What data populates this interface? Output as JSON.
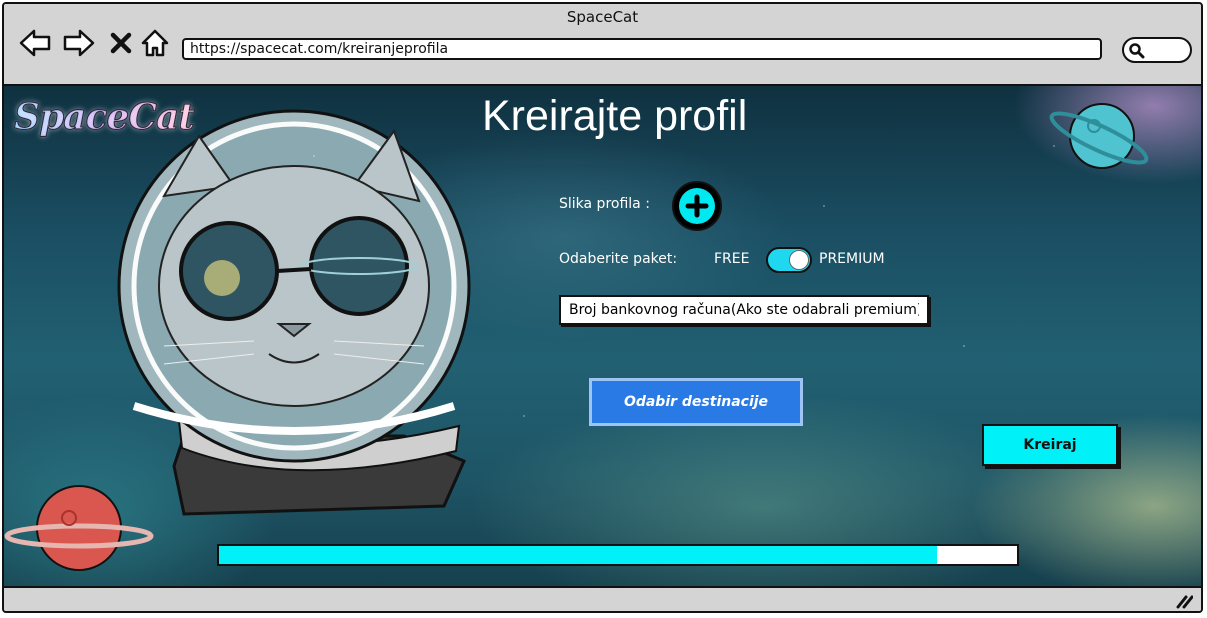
{
  "window": {
    "title": "SpaceCat"
  },
  "toolbar": {
    "back_icon": "arrow-left-icon",
    "forward_icon": "arrow-right-icon",
    "stop_icon": "close-icon",
    "home_icon": "home-icon",
    "url": "https://spacecat.com/kreiranjeprofila",
    "search_icon": "search-icon"
  },
  "logo": {
    "text": "SpaceCat"
  },
  "page": {
    "title": "Kreirajte profil"
  },
  "form": {
    "photo_label": "Slika profila :",
    "package_label": "Odaberite paket:",
    "package_free": "FREE",
    "package_premium": "PREMIUM",
    "package_selected": "PREMIUM",
    "bank_value": "Broj bankovnog računa(Ako ste odabrali premium)",
    "destination_button": "Odabir destinacije",
    "create_button": "Kreiraj"
  },
  "progress": {
    "value": 0.9
  },
  "colors": {
    "accent": "#00f2f8",
    "primary_button": "#2a7ae6",
    "toggle_on": "#1fd8f0"
  }
}
